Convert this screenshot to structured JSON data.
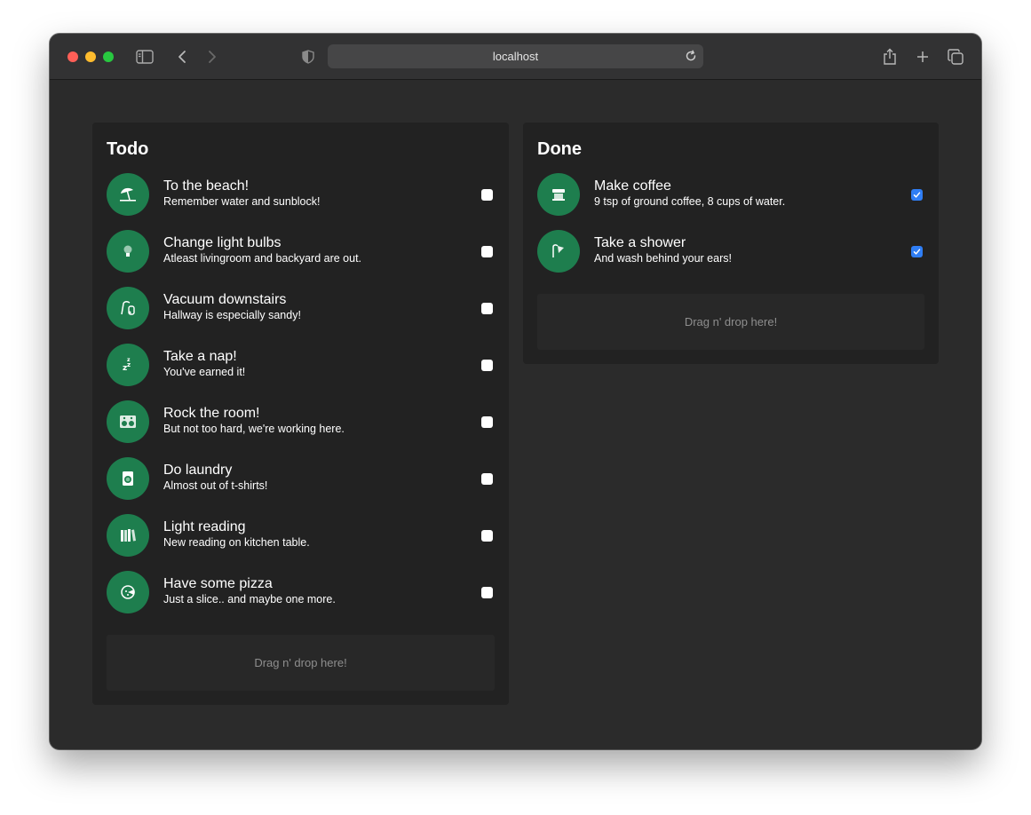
{
  "browser": {
    "url": "localhost"
  },
  "todo": {
    "title": "Todo",
    "dropzone": "Drag n' drop here!",
    "items": [
      {
        "title": "To the beach!",
        "subtitle": "Remember water and sunblock!",
        "icon": "beach-umbrella-icon",
        "checked": false
      },
      {
        "title": "Change light bulbs",
        "subtitle": "Atleast livingroom and backyard are out.",
        "icon": "light-bulb-icon",
        "checked": false
      },
      {
        "title": "Vacuum downstairs",
        "subtitle": "Hallway is especially sandy!",
        "icon": "vacuum-icon",
        "checked": false
      },
      {
        "title": "Take a nap!",
        "subtitle": "You've earned it!",
        "icon": "sleep-icon",
        "checked": false
      },
      {
        "title": "Rock the room!",
        "subtitle": "But not too hard, we're working here.",
        "icon": "speaker-icon",
        "checked": false
      },
      {
        "title": "Do laundry",
        "subtitle": "Almost out of t-shirts!",
        "icon": "washing-machine-icon",
        "checked": false
      },
      {
        "title": "Light reading",
        "subtitle": "New reading on kitchen table.",
        "icon": "books-icon",
        "checked": false
      },
      {
        "title": "Have some pizza",
        "subtitle": "Just a slice.. and maybe one more.",
        "icon": "pizza-icon",
        "checked": false
      }
    ]
  },
  "done": {
    "title": "Done",
    "dropzone": "Drag n' drop here!",
    "items": [
      {
        "title": "Make coffee",
        "subtitle": "9 tsp of ground coffee, 8 cups of water.",
        "icon": "coffee-maker-icon",
        "checked": true
      },
      {
        "title": "Take a shower",
        "subtitle": "And wash behind your ears!",
        "icon": "shower-icon",
        "checked": true
      }
    ]
  },
  "colors": {
    "accent": "#1e7e4e",
    "checkbox_checked": "#2f7ef5",
    "panel": "#222222",
    "background": "#2b2b2b"
  }
}
